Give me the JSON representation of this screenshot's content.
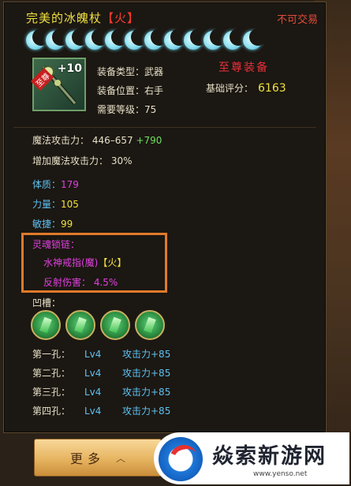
{
  "item": {
    "name": "完美的冰魄杖",
    "element_tag": "【火】",
    "trade_status": "不可交易",
    "moon_count": 12,
    "upgrade_level": "+10",
    "badge": "至尊",
    "equip_type": "装备类型：武器",
    "equip_slot": "装备位置：右手",
    "required_level": "需要等级：75",
    "supreme_label": "至尊装备",
    "base_score_label": "基础评分：",
    "base_score_value": "6163"
  },
  "stats": {
    "magic_attack_label": "魔法攻击力：",
    "magic_attack_range": "446–657",
    "magic_attack_bonus": "+790",
    "magic_attack_increase_label": "增加魔法攻击力：",
    "magic_attack_increase_value": "30%",
    "physique_label": "体质：",
    "physique_value": "179",
    "strength_label": "力量：",
    "strength_value": "105",
    "agility_label": "敏捷：",
    "agility_value": "99"
  },
  "soul_chain": {
    "title": "灵魂锁链：",
    "ring_name": "水神戒指(魔)",
    "ring_element": "【火】",
    "reflect_label": "反射伤害：",
    "reflect_value": "4.5%"
  },
  "slots": {
    "label": "凹槽：",
    "gem_count": 4,
    "holes": [
      {
        "name": "第一孔：",
        "level": "Lv4",
        "bonus": "攻击力+85"
      },
      {
        "name": "第二孔：",
        "level": "Lv4",
        "bonus": "攻击力+85"
      },
      {
        "name": "第三孔：",
        "level": "Lv4",
        "bonus": "攻击力+85"
      },
      {
        "name": "第四孔：",
        "level": "Lv4",
        "bonus": "攻击力+85"
      }
    ]
  },
  "buttons": {
    "more_label": "更多",
    "more_chevron": "︿"
  },
  "watermark": {
    "title": "焱索新游网",
    "url": "www.yenso.net"
  },
  "colors": {
    "title": "#f0e040",
    "element_red": "#ff3a2a",
    "soul_magenta": "#e040e0",
    "value_yellow": "#f0e040",
    "hole_blue": "#5ec0f0",
    "bonus_green": "#6ee060",
    "highlight_box": "#e07a2a"
  }
}
